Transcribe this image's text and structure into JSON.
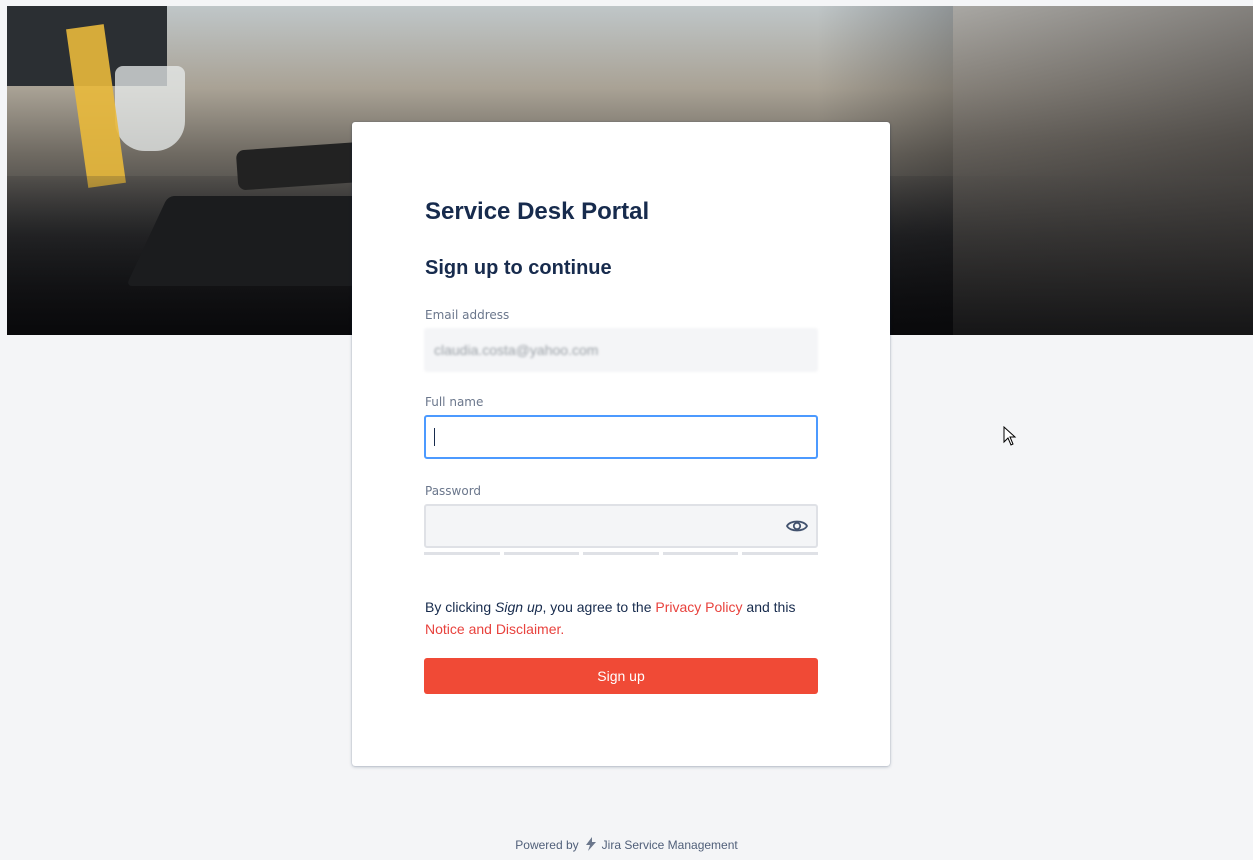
{
  "portal_title": "Service Desk Portal",
  "form_title": "Sign up to continue",
  "fields": {
    "email_label": "Email address",
    "email_value": "claudia.costa@yahoo.com",
    "name_label": "Full name",
    "name_value": "",
    "password_label": "Password",
    "password_value": ""
  },
  "terms": {
    "prefix": "By clicking ",
    "emphasis": "Sign up",
    "middle": ", you agree to the ",
    "privacy_link": "Privacy Policy",
    "connector": " and this ",
    "notice_link": "Notice and Disclaimer",
    "suffix": "."
  },
  "signup_button": "Sign up",
  "footer": {
    "powered_by": "Powered by",
    "product": "Jira Service Management"
  },
  "colors": {
    "accent": "#f04a36",
    "link": "#e8423d",
    "focus": "#4c9aff"
  },
  "icons": [
    "eye-icon",
    "jira-logo-icon",
    "mouse-pointer-icon"
  ]
}
